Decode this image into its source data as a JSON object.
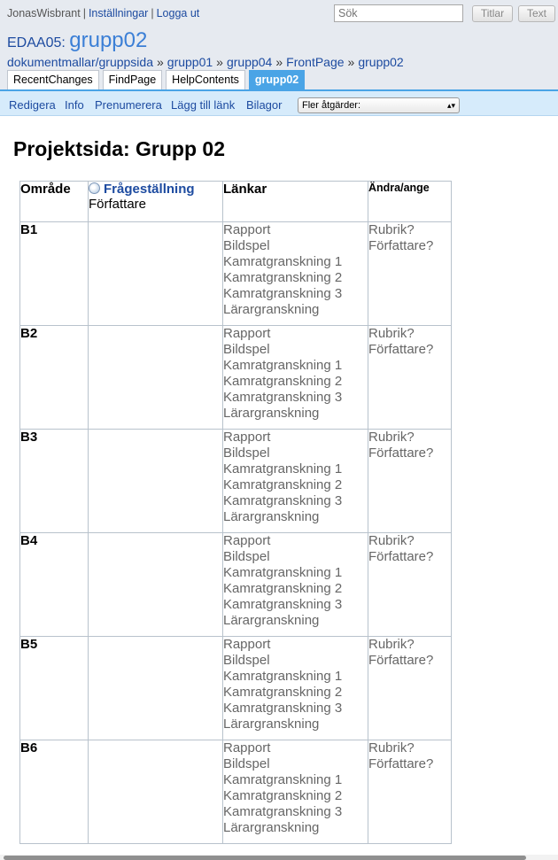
{
  "user": {
    "name": "JonasWisbrant",
    "settings": "Inställningar",
    "logout": "Logga ut",
    "sep": "|"
  },
  "search": {
    "placeholder": "Sök",
    "titles_button": "Titlar",
    "text_button": "Text"
  },
  "page": {
    "prefix": "EDAA05:",
    "name": "grupp02",
    "heading": "Projektsida: Grupp 02"
  },
  "breadcrumb": {
    "sep": "»",
    "items": [
      "dokumentmallar/gruppsida",
      "grupp01",
      "grupp04",
      "FrontPage",
      "grupp02"
    ]
  },
  "tabs": [
    "RecentChanges",
    "FindPage",
    "HelpContents",
    "grupp02"
  ],
  "actions": {
    "edit": "Redigera",
    "info": "Info",
    "subscribe": "Prenumerera",
    "add_link": "Lägg till länk",
    "attachments": "Bilagor",
    "more": "Fler åtgärder:"
  },
  "table": {
    "headers": {
      "area": "Område",
      "question": "Frågeställning",
      "author": "Författare",
      "links": "Länkar",
      "change": "Ändra/ange"
    },
    "rows": [
      {
        "area": "B1",
        "links": [
          "Rapport",
          "Bildspel",
          "Kamratgranskning 1",
          "Kamratgranskning 2",
          "Kamratgranskning 3",
          "Lärargranskning"
        ],
        "change": [
          "Rubrik?",
          "Författare?"
        ]
      },
      {
        "area": "B2",
        "links": [
          "Rapport",
          "Bildspel",
          "Kamratgranskning 1",
          "Kamratgranskning 2",
          "Kamratgranskning 3",
          "Lärargranskning"
        ],
        "change": [
          "Rubrik?",
          "Författare?"
        ]
      },
      {
        "area": "B3",
        "links": [
          "Rapport",
          "Bildspel",
          "Kamratgranskning 1",
          "Kamratgranskning 2",
          "Kamratgranskning 3",
          "Lärargranskning"
        ],
        "change": [
          "Rubrik?",
          "Författare?"
        ]
      },
      {
        "area": "B4",
        "links": [
          "Rapport",
          "Bildspel",
          "Kamratgranskning 1",
          "Kamratgranskning 2",
          "Kamratgranskning 3",
          "Lärargranskning"
        ],
        "change": [
          "Rubrik?",
          "Författare?"
        ]
      },
      {
        "area": "B5",
        "links": [
          "Rapport",
          "Bildspel",
          "Kamratgranskning 1",
          "Kamratgranskning 2",
          "Kamratgranskning 3",
          "Lärargranskning"
        ],
        "change": [
          "Rubrik?",
          "Författare?"
        ]
      },
      {
        "area": "B6",
        "links": [
          "Rapport",
          "Bildspel",
          "Kamratgranskning 1",
          "Kamratgranskning 2",
          "Kamratgranskning 3",
          "Lärargranskning"
        ],
        "change": [
          "Rubrik?",
          "Författare?"
        ]
      }
    ]
  },
  "colors": {
    "link": "#1d4ba0",
    "tab_active": "#4aa4e6",
    "header_bg": "#e6eaf0",
    "editbar_bg": "#d6ebfb",
    "missing_link": "#666666"
  }
}
